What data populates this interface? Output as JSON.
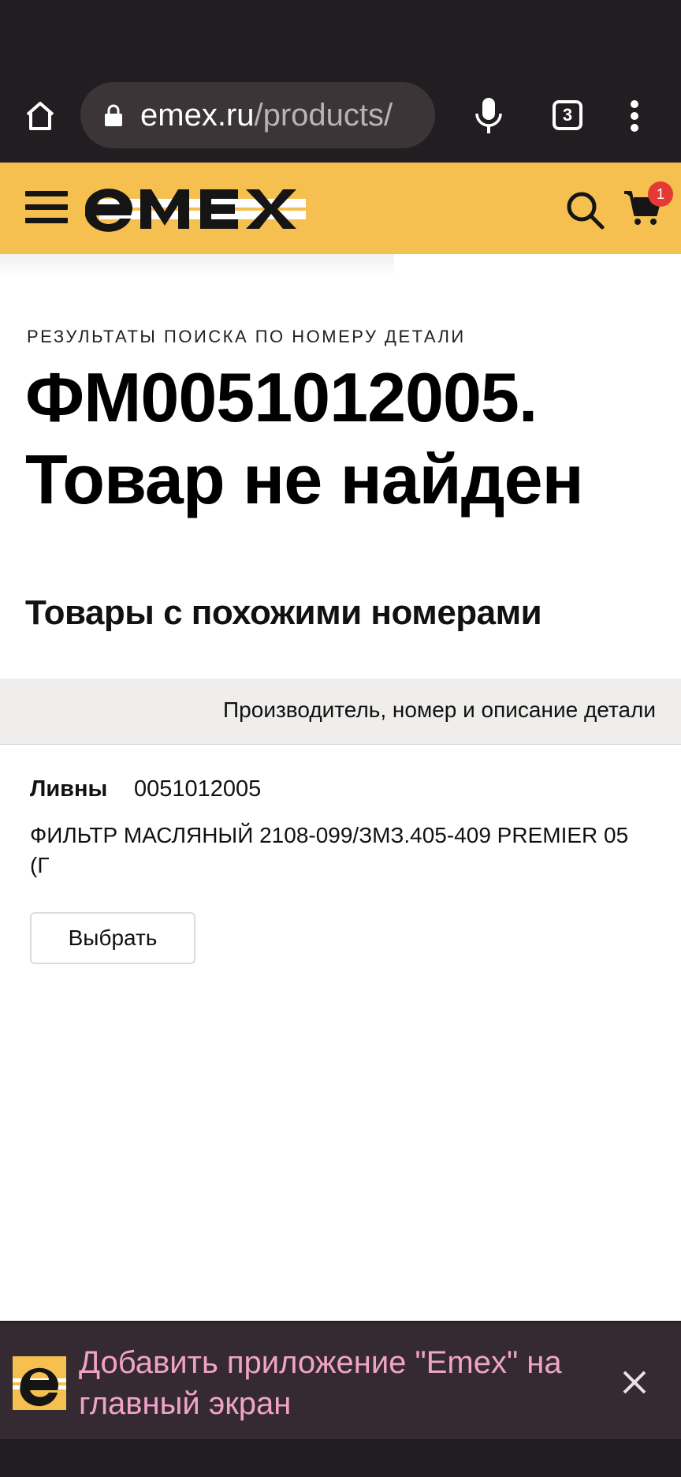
{
  "browser": {
    "url_host": "emex.ru",
    "url_path": "/products/",
    "tab_count": "3",
    "icons": [
      "home-icon",
      "lock-icon",
      "mic-icon",
      "tabs-icon",
      "more-icon"
    ]
  },
  "header": {
    "logo_text": "EMEX",
    "cart_count": "1",
    "brand_color": "#f5c04f",
    "badge_color": "#e53935"
  },
  "main": {
    "kicker": "РЕЗУЛЬТАТЫ ПОИСКА ПО НОМЕРУ ДЕТАЛИ",
    "title": "ФМ0051012005. Товар не найден",
    "similar_heading": "Товары с похожими номерами",
    "table_header": "Производитель, номер и описание детали",
    "results": [
      {
        "brand": "Ливны",
        "part_number": "0051012005",
        "description": "ФИЛЬТР МАСЛЯНЫЙ 2108-099/ЗМЗ.405-409 PREMIER 05 (Г",
        "button_label": "Выбрать"
      }
    ]
  },
  "install_banner": {
    "text": "Добавить приложение \"Emex\" на главный экран",
    "text_color": "#f0a3c9"
  }
}
